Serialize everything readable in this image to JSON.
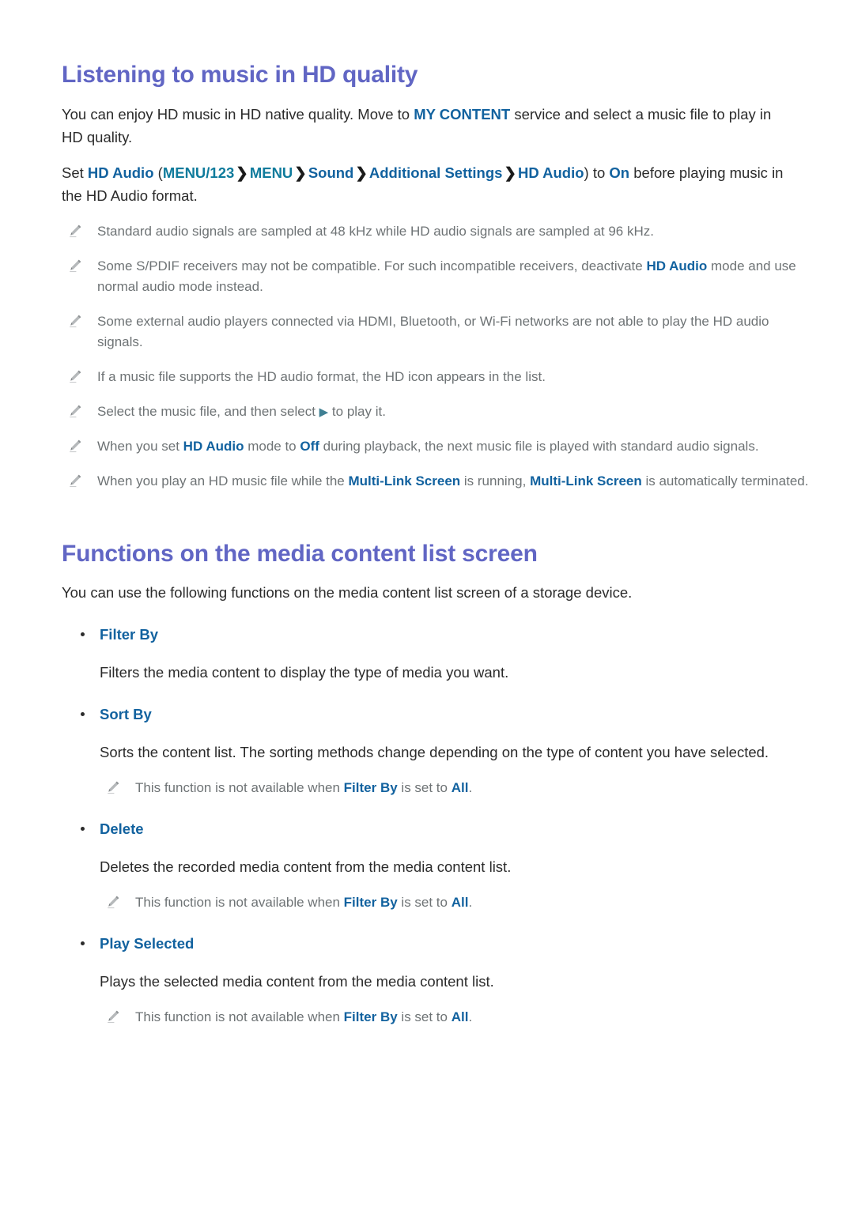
{
  "sections": [
    {
      "id": "listening-hd",
      "title": "Listening to music in HD quality",
      "intro_1a": "You can enjoy HD music in HD native quality. Move to ",
      "intro_1b": "MY CONTENT",
      "intro_1c": " service and select a music file to play in HD quality.",
      "menu_path": {
        "lead": "Set ",
        "item": "HD Audio",
        "open_paren": " (",
        "steps": [
          "MENU/123",
          "MENU",
          "Sound",
          "Additional Settings",
          "HD Audio"
        ],
        "separator": "❯",
        "close_paren": ")",
        "mid": " to ",
        "value": "On",
        "tail": " before playing music in the HD Audio format."
      },
      "notes": [
        {
          "parts": [
            {
              "t": "Standard audio signals are sampled at 48 kHz while HD audio signals are sampled at 96 kHz.",
              "style": "plain"
            }
          ]
        },
        {
          "parts": [
            {
              "t": "Some S/PDIF receivers may not be compatible. For such incompatible receivers, deactivate ",
              "style": "plain"
            },
            {
              "t": "HD Audio",
              "style": "blue"
            },
            {
              "t": " mode and use normal audio mode instead.",
              "style": "plain"
            }
          ]
        },
        {
          "parts": [
            {
              "t": "Some external audio players connected via HDMI, Bluetooth, or Wi-Fi networks are not able to play the HD audio signals.",
              "style": "plain"
            }
          ]
        },
        {
          "parts": [
            {
              "t": "If a music file supports the HD audio format, the HD icon appears in the list.",
              "style": "plain"
            }
          ]
        },
        {
          "parts": [
            {
              "t": "Select the music file, and then select ",
              "style": "plain"
            },
            {
              "t": "▶",
              "style": "play"
            },
            {
              "t": " to play it.",
              "style": "plain"
            }
          ]
        },
        {
          "parts": [
            {
              "t": "When you set ",
              "style": "plain"
            },
            {
              "t": "HD Audio",
              "style": "blue"
            },
            {
              "t": " mode to ",
              "style": "plain"
            },
            {
              "t": "Off",
              "style": "blue"
            },
            {
              "t": " during playback, the next music file is played with standard audio signals.",
              "style": "plain"
            }
          ]
        },
        {
          "parts": [
            {
              "t": "When you play an HD music file while the ",
              "style": "plain"
            },
            {
              "t": "Multi-Link Screen",
              "style": "blue"
            },
            {
              "t": " is running, ",
              "style": "plain"
            },
            {
              "t": "Multi-Link Screen",
              "style": "blue"
            },
            {
              "t": " is automatically terminated.",
              "style": "plain"
            }
          ]
        }
      ]
    },
    {
      "id": "media-list-functions",
      "title": "Functions on the media content list screen",
      "intro": "You can use the following functions on the media content list screen of a storage device.",
      "items": [
        {
          "label": "Filter By",
          "description": "Filters the media content to display the type of media you want.",
          "notes": []
        },
        {
          "label": "Sort By",
          "description": "Sorts the content list. The sorting methods change depending on the type of content you have selected.",
          "notes": [
            {
              "parts": [
                {
                  "t": "This function is not available when ",
                  "style": "plain"
                },
                {
                  "t": "Filter By",
                  "style": "blue"
                },
                {
                  "t": " is set to ",
                  "style": "plain"
                },
                {
                  "t": "All",
                  "style": "blue"
                },
                {
                  "t": ".",
                  "style": "plain"
                }
              ]
            }
          ]
        },
        {
          "label": "Delete",
          "description": "Deletes the recorded media content from the media content list.",
          "notes": [
            {
              "parts": [
                {
                  "t": "This function is not available when ",
                  "style": "plain"
                },
                {
                  "t": "Filter By",
                  "style": "blue"
                },
                {
                  "t": " is set to ",
                  "style": "plain"
                },
                {
                  "t": "All",
                  "style": "blue"
                },
                {
                  "t": ".",
                  "style": "plain"
                }
              ]
            }
          ]
        },
        {
          "label": "Play Selected",
          "description": "Plays the selected media content from the media content list.",
          "notes": [
            {
              "parts": [
                {
                  "t": "This function is not available when ",
                  "style": "plain"
                },
                {
                  "t": "Filter By",
                  "style": "blue"
                },
                {
                  "t": " is set to ",
                  "style": "plain"
                },
                {
                  "t": "All",
                  "style": "blue"
                },
                {
                  "t": ".",
                  "style": "plain"
                }
              ]
            }
          ]
        }
      ]
    }
  ],
  "icons": {
    "note": "pencil-icon",
    "bullet": "bullet-dot-icon",
    "play": "play-triangle-icon"
  },
  "colors": {
    "heading": "#6166c4",
    "link_blue": "#12629f",
    "menu_teal": "#0f7b9c",
    "body": "#2b2b2b",
    "note_gray": "#6e7375"
  }
}
